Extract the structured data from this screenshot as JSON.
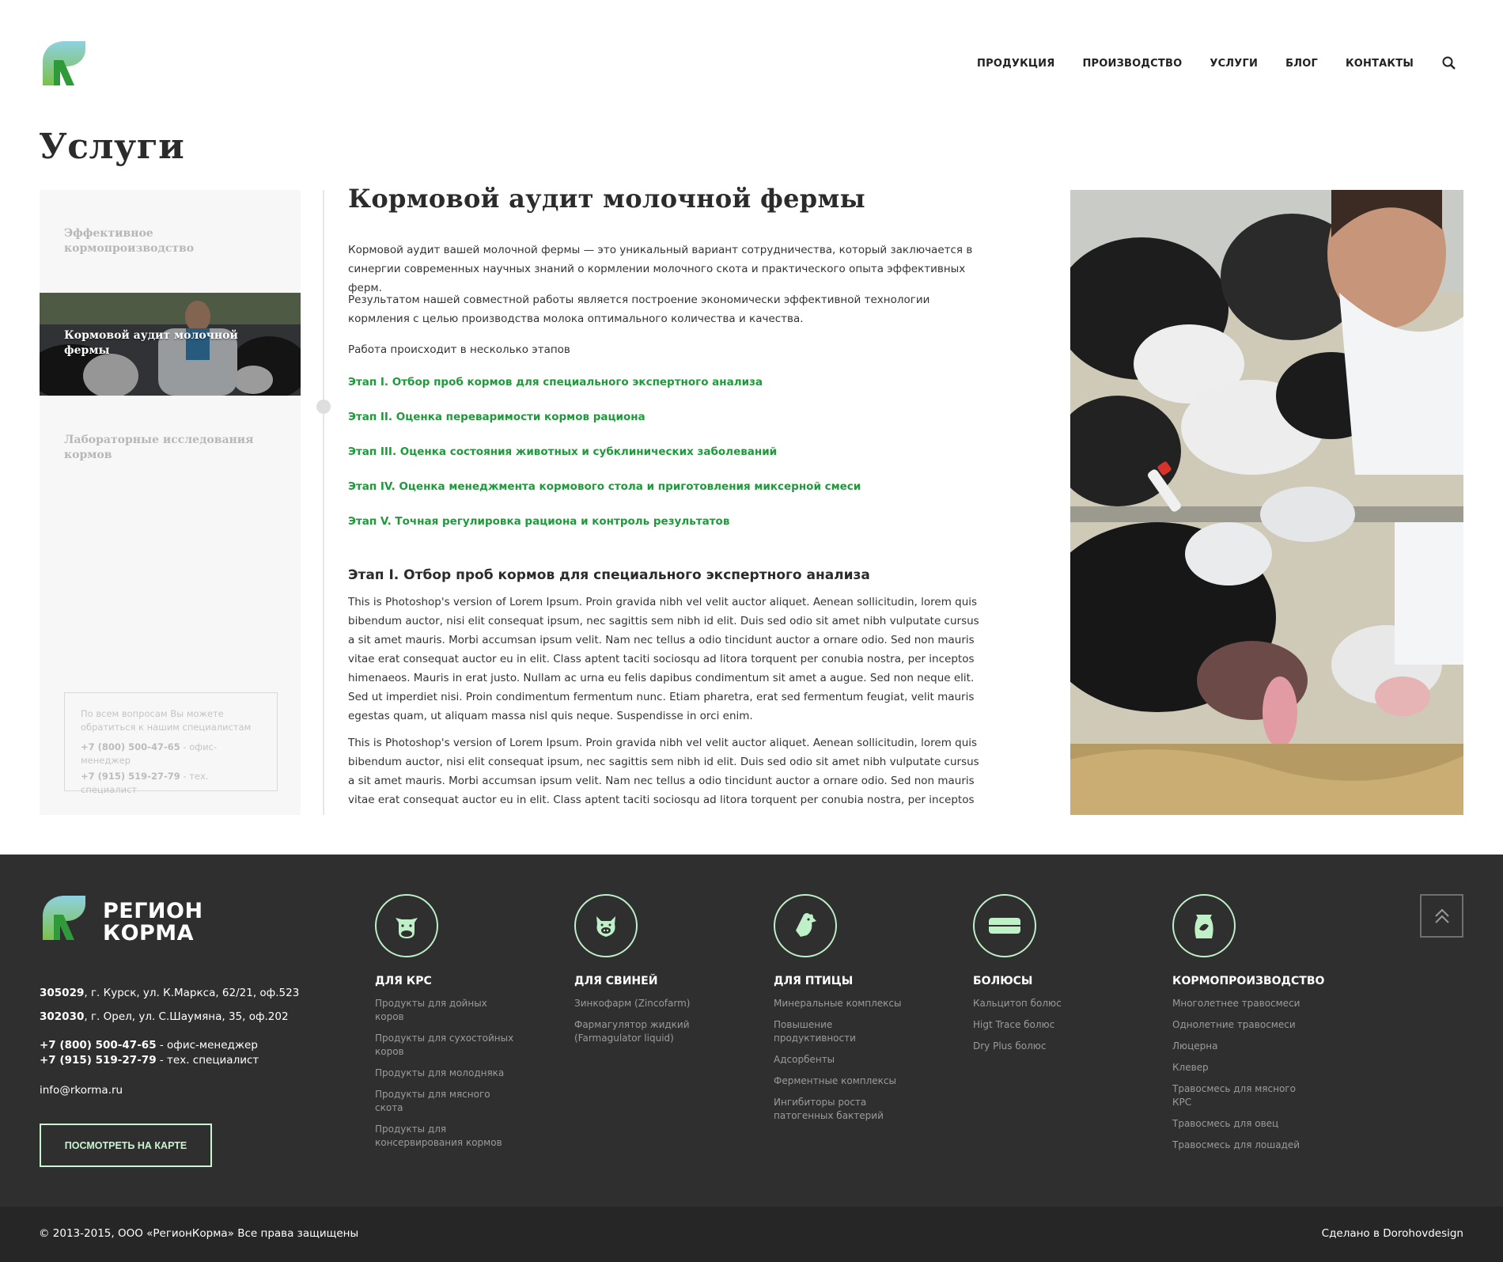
{
  "header": {
    "nav": [
      "ПРОДУКЦИЯ",
      "ПРОИЗВОДСТВО",
      "УСЛУГИ",
      "БЛОГ",
      "КОНТАКТЫ"
    ]
  },
  "page_title": "Услуги",
  "sidebar": {
    "items": [
      "Эффективное кормопроизводство",
      "Кормовой аудит молочной фермы",
      "Лабораторные исследования кормов"
    ],
    "contact": {
      "text": "По всем вопросам Вы можете обратиться к нашим специалистам",
      "phone1": "+7 (800) 500-47-65",
      "role1": " - офис-менеджер",
      "phone2": "+7 (915) 519-27-79",
      "role2": " - тех. специалист"
    }
  },
  "main": {
    "title": "Кормовой аудит молочной фермы",
    "p1": "Кормовой аудит вашей молочной фермы — это уникальный вариант сотрудничества, который заключается в синергии современных научных знаний о кормлении молочного скота и практического опыта эффективных ферм.",
    "p2": "Результатом нашей совместной работы является построение экономически эффективной технологии кормления с целью производства молока оптимального количества и качества.",
    "p3": "Работа происходит в несколько этапов",
    "stages": [
      "Этап I. Отбор проб кормов для специального экспертного анализа",
      "Этап II. Оценка переваримости кормов рациона",
      "Этап III. Оценка состояния животных и субклинических заболеваний",
      "Этап IV. Оценка менеджмента кормового стола и приготовления миксерной смеси",
      "Этап V. Точная регулировка рациона и контроль результатов"
    ],
    "section_title": "Этап I. Отбор проб кормов для специального экспертного анализа",
    "lorem1": "This is Photoshop's version  of Lorem Ipsum. Proin gravida nibh vel velit auctor aliquet. Aenean sollicitudin, lorem quis bibendum auctor, nisi elit consequat ipsum, nec sagittis sem nibh id elit. Duis sed odio sit amet nibh vulputate cursus a sit amet mauris. Morbi accumsan ipsum velit. Nam nec tellus a odio tincidunt auctor a ornare odio. Sed non  mauris vitae erat consequat auctor eu in elit. Class aptent taciti sociosqu ad litora torquent per conubia nostra, per inceptos himenaeos. Mauris in erat justo. Nullam ac urna eu felis dapibus condimentum sit amet a augue. Sed non neque elit. Sed ut imperdiet nisi. Proin condimentum fermentum nunc. Etiam pharetra, erat sed fermentum feugiat, velit mauris egestas quam, ut aliquam massa nisl quis neque. Suspendisse in orci enim.",
    "lorem2": "This is Photoshop's version  of Lorem Ipsum. Proin gravida nibh vel velit auctor aliquet. Aenean sollicitudin, lorem quis bibendum auctor, nisi elit consequat ipsum, nec sagittis sem nibh id elit. Duis sed odio sit amet nibh vulputate cursus a sit amet mauris. Morbi accumsan ipsum velit. Nam nec tellus a odio tincidunt auctor a ornare odio. Sed non  mauris vitae erat consequat auctor eu in elit. Class aptent taciti sociosqu ad litora torquent per conubia nostra, per inceptos himenaeos."
  },
  "footer": {
    "brand_line1": "РЕГИОН",
    "brand_line2": "КОРМА",
    "addr1_zip": "305029",
    "addr1": ", г. Курск, ул. К.Маркса, 62/21, оф.523",
    "addr2_zip": "302030",
    "addr2": ", г. Орел, ул. С.Шаумяна, 35, оф.202",
    "phone1": "+7 (800) 500-47-65",
    "role1": " - офис-менеджер",
    "phone2": "+7 (915) 519-27-79",
    "role2": " - тех. специалист",
    "email": "info@rkorma.ru",
    "map_button": "ПОСМОТРЕТЬ НА КАРТЕ",
    "columns": [
      {
        "title": "ДЛЯ КРС",
        "icon": "cow-icon",
        "items": [
          "Продукты для дойных коров",
          "Продукты для сухостойных коров",
          "Продукты для молодняка",
          "Продукты для мясного скота",
          "Продукты для консервирования кормов"
        ]
      },
      {
        "title": "ДЛЯ СВИНЕЙ",
        "icon": "pig-icon",
        "items": [
          "Зинкофарм (Zincofarm)",
          "Фармагулятор жидкий (Farmagulator liquid)"
        ]
      },
      {
        "title": "ДЛЯ ПТИЦЫ",
        "icon": "chicken-icon",
        "items": [
          "Минеральные комплексы",
          "Повышение продуктивности",
          "Адсорбенты",
          "Ферментные комплексы",
          "Ингибиторы роста патогенных бактерий"
        ]
      },
      {
        "title": "БОЛЮСЫ",
        "icon": "bolus-icon",
        "items": [
          "Кальцитоп болюс",
          "Higt Trace болюс",
          "Dry Plus болюс"
        ]
      },
      {
        "title": "КОРМОПРОИЗВОДСТВО",
        "icon": "feed-bag-icon",
        "items": [
          "Многолетнее травосмеси",
          "Однолетние травосмеси",
          "Люцерна",
          "Клевер",
          "Травосмесь для мясного КРС",
          "Травосмесь для овец",
          "Травосмесь для лошадей"
        ]
      }
    ],
    "copyright": "© 2013-2015, ООО «РегионКорма»  Все права защищены",
    "made_by": "Сделано в Dorohovdesign"
  },
  "colors": {
    "accent_green": "#1f9a3a",
    "footer_bg": "#2f2f2f",
    "footer_accent": "#bff0c7"
  }
}
